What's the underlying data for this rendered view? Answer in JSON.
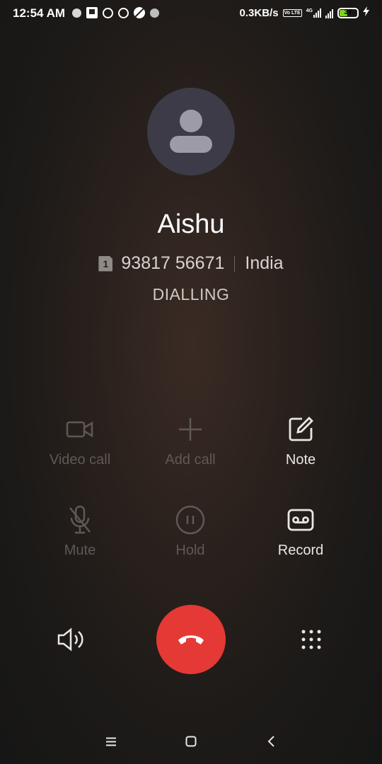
{
  "status_bar": {
    "time": "12:54 AM",
    "net_speed": "0.3KB/s",
    "volte": "Vo LTE",
    "network": "4G",
    "battery": "37",
    "battery_color": "#7ed321"
  },
  "contact": {
    "name": "Aishu",
    "sim": "1",
    "number": "93817 56671",
    "location": "India",
    "status": "DIALLING"
  },
  "actions": {
    "video_call": "Video call",
    "add_call": "Add call",
    "note": "Note",
    "mute": "Mute",
    "hold": "Hold",
    "record": "Record"
  },
  "colors": {
    "end_call": "#e53935",
    "disabled_text": "#5f5955",
    "enabled_text": "#e9e6e3"
  }
}
